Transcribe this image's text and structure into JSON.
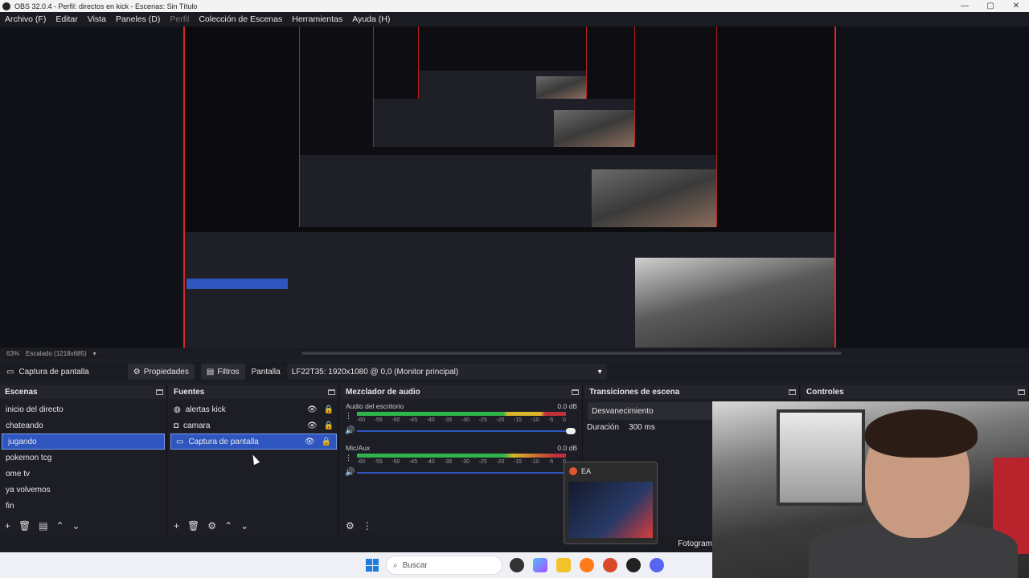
{
  "window": {
    "title": "OBS 32.0.4 - Perfil: directos en kick - Escenas: Sin Título"
  },
  "menu": [
    "Archivo (F)",
    "Editar",
    "Vista",
    "Paneles (D)",
    "Perfil",
    "Colección de Escenas",
    "Herramientas",
    "Ayuda (H)"
  ],
  "preview": {
    "zoom": "63%",
    "scale_label": "Escalado (1218x685)"
  },
  "source_bar": {
    "source_name": "Captura de pantalla",
    "properties_label": "Propiedades",
    "filters_label": "Filtros",
    "display_label": "Pantalla",
    "display_value": "LF22T35: 1920x1080 @ 0,0 (Monitor principal)"
  },
  "scenes": {
    "title": "Escenas",
    "items": [
      "inicio del directo",
      "chateando",
      "jugando",
      "pokemon tcg",
      "ome tv",
      "ya volvemos",
      "fin"
    ],
    "selected": "jugando"
  },
  "sources": {
    "title": "Fuentes",
    "items": [
      {
        "name": "alertas kick",
        "icon": "globe-icon"
      },
      {
        "name": "camara",
        "icon": "camera-icon"
      },
      {
        "name": "Captura de pantalla",
        "icon": "monitor-icon"
      }
    ],
    "selected": "Captura de pantalla"
  },
  "mixer": {
    "title": "Mezclador de audio",
    "channels": [
      {
        "name": "Audio del escritorio",
        "level": "0.0 dB"
      },
      {
        "name": "Mic/Aux",
        "level": "0.0 dB"
      }
    ],
    "ticks": [
      "-60",
      "-55",
      "-50",
      "-45",
      "-40",
      "-35",
      "-30",
      "-25",
      "-20",
      "-15",
      "-10",
      "-5",
      "0"
    ]
  },
  "transitions": {
    "title": "Transiciones de escena",
    "type": "Desvanecimiento",
    "duration_label": "Duración",
    "duration_value": "300 ms"
  },
  "controls": {
    "title": "Controles"
  },
  "status": {
    "partial": "Fotogram"
  },
  "thumbnail": {
    "app": "EA"
  },
  "taskbar": {
    "search_placeholder": "Buscar"
  }
}
